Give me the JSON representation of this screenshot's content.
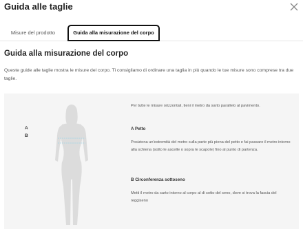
{
  "modal": {
    "title": "Guida alle taglie",
    "close_icon": "close-icon"
  },
  "tabs": [
    {
      "label": "Misure del prodotto",
      "active": false
    },
    {
      "label": "Guida alla misurazione del corpo",
      "active": true
    }
  ],
  "content": {
    "heading": "Guida alla misurazione del corpo",
    "intro": "Queste guide alle taglie mostra le misure del corpo. Ti consigliamo di ordinare una taglia in più quando le tue misure sono comprese tra due taglie.",
    "figure_icon": "body-silhouette-icon",
    "markers": {
      "a": "A",
      "b": "B"
    },
    "general_note": "Per tutte le misure orizzontali, tieni il metro da sarto parallelo al pavimento.",
    "measure_a_title": "A Petto",
    "measure_a_text": "Posiziona un'estremità del metro sulla parte più piena del petto e fai passare il metro intorno alla schiena (sotto le ascelle o sopra le scapole) fino al punto di partenza.",
    "measure_b_title": "B Circonferenza sottoseno",
    "measure_b_text": "Metti il metro da sarto intorno al corpo al di sotto del seno, dove si trova la fascia del reggiseno"
  },
  "colors": {
    "panel_bg": "#f5f5f5",
    "silhouette": "#dcdcdc",
    "measure_line": "#9fd3e6"
  }
}
